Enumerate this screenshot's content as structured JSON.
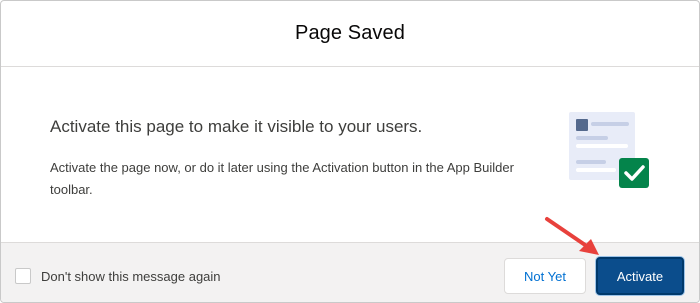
{
  "modal": {
    "title": "Page Saved",
    "headline": "Activate this page to make it visible to your users.",
    "description": "Activate the page now, or do it later using the Activation button in the App Builder toolbar."
  },
  "illustration": {
    "icon": "document-check-icon",
    "check_color": "#04844b",
    "doc_color": "#e8ecf8"
  },
  "footer": {
    "checkbox_label": "Don't show this message again",
    "checkbox_checked": false,
    "not_yet_label": "Not Yet",
    "activate_label": "Activate"
  },
  "annotation": {
    "arrow_color": "#e8413c"
  },
  "colors": {
    "brand": "#0b4d8c",
    "link": "#0070d2",
    "footer_bg": "#f3f2f2"
  }
}
